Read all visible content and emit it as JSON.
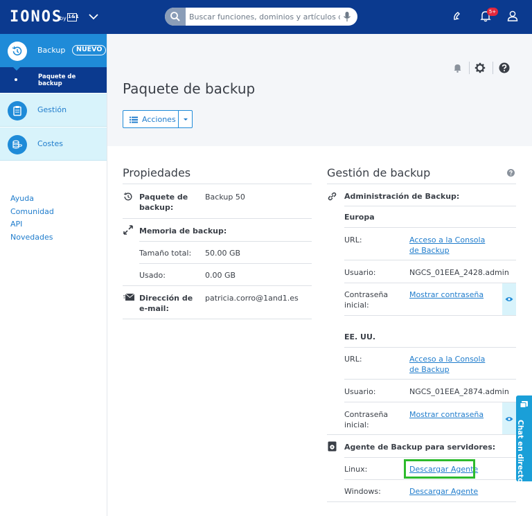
{
  "header": {
    "logo": "IONOS",
    "logo_by": "by",
    "logo_1and1": "1&1",
    "search_placeholder": "Buscar funciones, dominios y artículos de ...",
    "notification_count": "5+"
  },
  "sidebar": {
    "main_label": "Backup",
    "main_badge": "NUEVO",
    "sub_label": "Paquete de backup",
    "items": [
      {
        "label": "Gestión"
      },
      {
        "label": "Costes"
      }
    ],
    "links": [
      "Ayuda",
      "Comunidad",
      "API",
      "Novedades"
    ]
  },
  "page": {
    "title": "Paquete de backup",
    "actions_label": "Acciones"
  },
  "properties": {
    "title": "Propiedades",
    "package_label": "Paquete de backup:",
    "package_value": "Backup 50",
    "memory_label": "Memoria de backup:",
    "total_label": "Tamaño total:",
    "total_value": "50.00 GB",
    "used_label": "Usado:",
    "used_value": "0.00 GB",
    "email_label": "Dirección de e-mail:",
    "email_value": "patricia.corro@1and1.es"
  },
  "management": {
    "title": "Gestión de backup",
    "admin_label": "Administración de Backup:",
    "regions": [
      {
        "name": "Europa",
        "url_label": "URL:",
        "url_link": "Acceso a la Consola de Backup",
        "user_label": "Usuario:",
        "user_value": "NGCS_01EEA_2428.admin",
        "pass_label": "Contraseña inicial:",
        "pass_link": "Mostrar contraseña"
      },
      {
        "name": "EE. UU.",
        "url_label": "URL:",
        "url_link": "Acceso a la Consola de Backup",
        "user_label": "Usuario:",
        "user_value": "NGCS_01EEA_2874.admin",
        "pass_label": "Contraseña inicial:",
        "pass_link": "Mostrar contraseña"
      }
    ],
    "agent_label": "Agente de Backup para servidores:",
    "linux_label": "Linux:",
    "linux_link": "Descargar Agente",
    "windows_label": "Windows:",
    "windows_link": "Descargar Agente"
  },
  "chat": {
    "label": "Chat en directo"
  },
  "colors": {
    "brand_dark": "#0b3a8f",
    "brand_blue": "#1f8bd8",
    "light_cyan": "#d8f3fb",
    "highlight_green": "#2dbb2d"
  }
}
